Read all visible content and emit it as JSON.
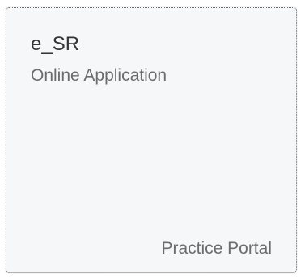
{
  "tile": {
    "title": "e_SR",
    "subtitle": "Online Application",
    "footer": "Practice Portal"
  }
}
